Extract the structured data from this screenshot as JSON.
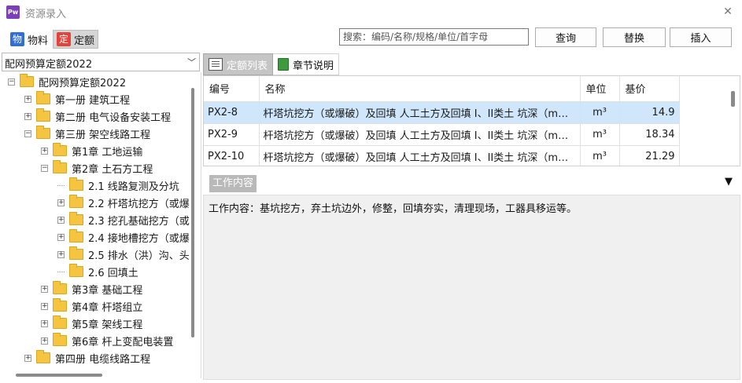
{
  "window": {
    "app_icon": "Pw",
    "title": "资源录入",
    "close_glyph": "✕"
  },
  "toolbar": {
    "material_badge": "物",
    "material_label": "物料",
    "quota_badge": "定",
    "quota_label": "定额",
    "search_placeholder": "搜索：编码/名称/规格/单位/首字母",
    "query_label": "查询",
    "replace_label": "替换",
    "insert_label": "插入"
  },
  "tree": {
    "selected_library": "配网预算定额2022",
    "items": [
      {
        "label": "配网预算定额2022",
        "toggle": "-"
      },
      {
        "label": "第一册 建筑工程",
        "toggle": "+"
      },
      {
        "label": "第二册 电气设备安装工程",
        "toggle": "+"
      },
      {
        "label": "第三册 架空线路工程",
        "toggle": "-"
      },
      {
        "label": "第1章 工地运输",
        "toggle": "+"
      },
      {
        "label": "第2章 土石方工程",
        "toggle": "-"
      },
      {
        "label": "2.1 线路复测及分坑",
        "toggle": ""
      },
      {
        "label": "2.2 杆塔坑挖方（或爆",
        "toggle": "+"
      },
      {
        "label": "2.3 挖孔基础挖方（或",
        "toggle": "+"
      },
      {
        "label": "2.4 接地槽挖方（或爆",
        "toggle": "+"
      },
      {
        "label": "2.5 排水（洪）沟、头",
        "toggle": "+"
      },
      {
        "label": "2.6 回填土",
        "toggle": ""
      },
      {
        "label": "第3章 基础工程",
        "toggle": "+"
      },
      {
        "label": "第4章 杆塔组立",
        "toggle": "+"
      },
      {
        "label": "第5章 架线工程",
        "toggle": "+"
      },
      {
        "label": "第6章 杆上变配电装置",
        "toggle": "+"
      },
      {
        "label": "第四册 电缆线路工程",
        "toggle": "+"
      }
    ]
  },
  "tabs": {
    "quota_list": "定额列表",
    "chapter_notes": "章节说明"
  },
  "table": {
    "columns": [
      "编号",
      "名称",
      "单位",
      "基价"
    ],
    "rows": [
      {
        "code": "PX2-8",
        "name": "杆塔坑挖方（或爆破）及回填 人工土方及回填 I、II类土 坑深（m）…",
        "unit": "m³",
        "price": "14.9"
      },
      {
        "code": "PX2-9",
        "name": "杆塔坑挖方（或爆破）及回填 人工土方及回填 I、II类土 坑深（m）…",
        "unit": "m³",
        "price": "18.34"
      },
      {
        "code": "PX2-10",
        "name": "杆塔坑挖方（或爆破）及回填 人工土方及回填 I、II类土 坑深（m）…",
        "unit": "m³",
        "price": "21.29"
      }
    ]
  },
  "work": {
    "tab_label": "工作内容",
    "collapse_glyph": "▼",
    "content": "工作内容：基坑挖方，弃土坑边外，修整，回填夯实，清理现场，工器具移运等。"
  }
}
